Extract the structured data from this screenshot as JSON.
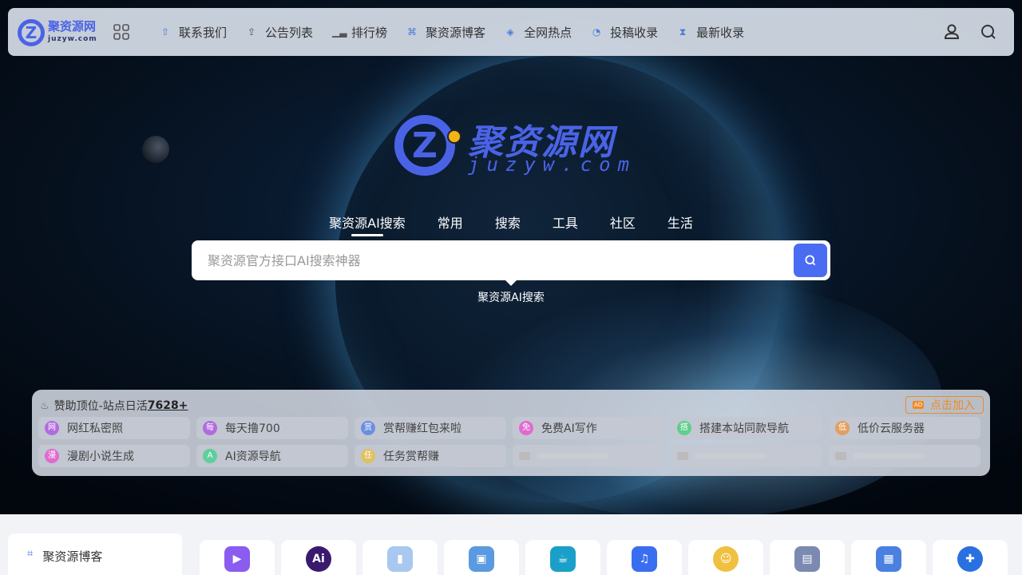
{
  "navbar": {
    "logo_text": "聚资源网",
    "logo_sub": "juzyw.com",
    "items": [
      {
        "label": "联系我们",
        "icon": "rocket-icon"
      },
      {
        "label": "公告列表",
        "icon": "upload-icon"
      },
      {
        "label": "排行榜",
        "icon": "bar-chart-icon"
      },
      {
        "label": "聚资源博客",
        "icon": "nodes-icon"
      },
      {
        "label": "全网热点",
        "icon": "layers-icon"
      },
      {
        "label": "投稿收录",
        "icon": "pie-icon"
      },
      {
        "label": "最新收录",
        "icon": "hourglass-icon"
      }
    ]
  },
  "hero": {
    "logo_title": "聚资源网",
    "logo_sub": "juzyw.com"
  },
  "search": {
    "tabs": [
      "聚资源AI搜索",
      "常用",
      "搜索",
      "工具",
      "社区",
      "生活"
    ],
    "active_tab": 0,
    "placeholder": "聚资源官方接口AI搜索神器",
    "engine_label": "聚资源AI搜索"
  },
  "sponsor": {
    "title": "赞助顶位-站点日活",
    "count": "7628+",
    "join_label": "点击加入",
    "items": [
      {
        "badge": "网",
        "label": "网红私密照",
        "color": "#b36be0"
      },
      {
        "badge": "每",
        "label": "每天撸700",
        "color": "#b36be0"
      },
      {
        "badge": "赏",
        "label": "赏帮赚红包来啦",
        "color": "#6b8ee0"
      },
      {
        "badge": "免",
        "label": "免费AI写作",
        "color": "#e06bd0"
      },
      {
        "badge": "搭",
        "label": "搭建本站同款导航",
        "color": "#5fcf8c"
      },
      {
        "badge": "低",
        "label": "低价云服务器",
        "color": "#e0a060"
      },
      {
        "badge": "漫",
        "label": "漫剧小说生成",
        "color": "#e06bd0"
      },
      {
        "badge": "A",
        "label": "AI资源导航",
        "color": "#5fcf9c"
      },
      {
        "badge": "任",
        "label": "任务赏帮赚",
        "color": "#e0c060"
      }
    ]
  },
  "bottom": {
    "blog_label": "聚资源博客",
    "apps": [
      {
        "icon": "video-app-icon",
        "color": "#8a5cf0",
        "glyph": "▶"
      },
      {
        "icon": "ai-app-icon",
        "color": "#3a1a6e",
        "glyph": "Ai"
      },
      {
        "icon": "book-app-icon",
        "color": "#a8c8f0",
        "glyph": "▮"
      },
      {
        "icon": "browser-app-icon",
        "color": "#5a9ae0",
        "glyph": "▣"
      },
      {
        "icon": "coffee-app-icon",
        "color": "#1aa0c8",
        "glyph": "☕"
      },
      {
        "icon": "music-app-icon",
        "color": "#3a6ef0",
        "glyph": "♫"
      },
      {
        "icon": "emoji-app-icon",
        "color": "#f0c040",
        "glyph": "☺"
      },
      {
        "icon": "desk-app-icon",
        "color": "#7a8ab0",
        "glyph": "▤"
      },
      {
        "icon": "dashboard-app-icon",
        "color": "#4a80e0",
        "glyph": "▦"
      },
      {
        "icon": "pie-app-icon",
        "color": "#2a70e0",
        "glyph": "✚"
      }
    ]
  }
}
